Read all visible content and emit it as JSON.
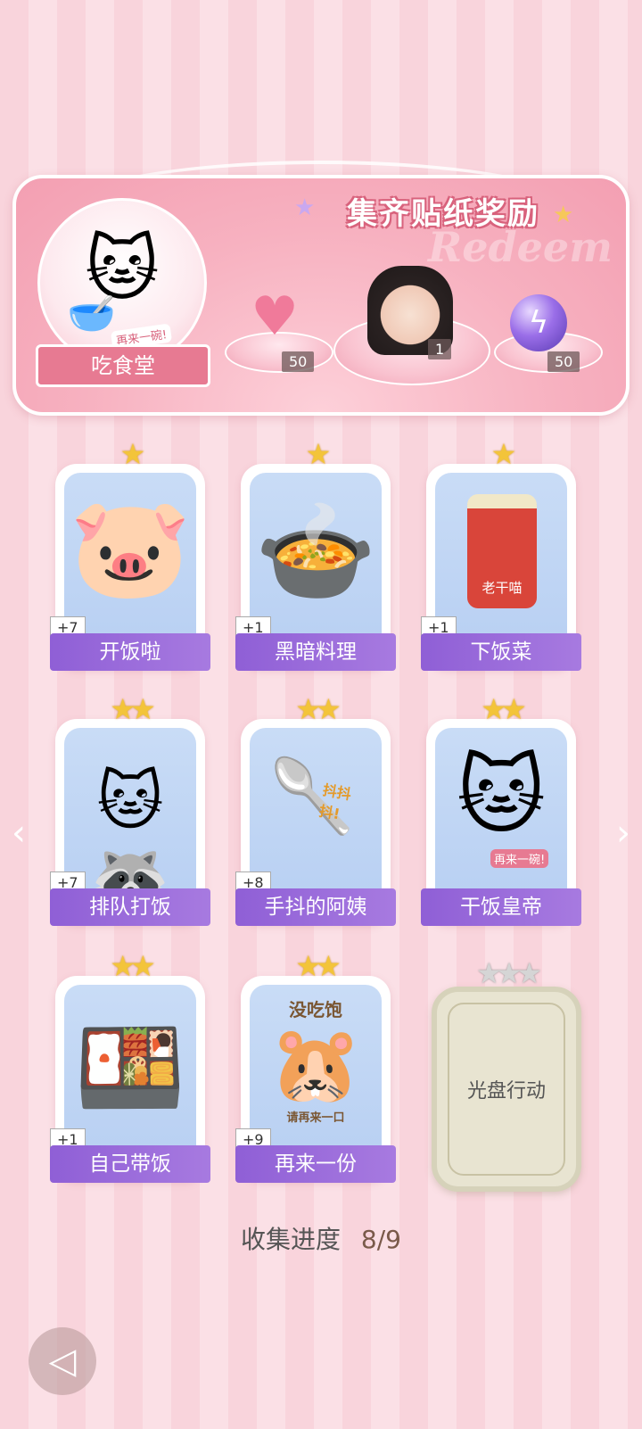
{
  "banner": {
    "title": "集齐贴纸奖励",
    "watermark": "Redeem",
    "badge_label": "吃食堂",
    "badge_sticker_text": "再来一碗!",
    "rewards": [
      {
        "icon": "heart-gem-icon",
        "count": "50"
      },
      {
        "icon": "hairstyle-portrait-icon",
        "count": "1"
      },
      {
        "icon": "purple-energy-orb-icon",
        "count": "50"
      }
    ]
  },
  "cards": [
    {
      "label": "开饭啦",
      "count": "+7",
      "stars": 1,
      "art": "🐷"
    },
    {
      "label": "黑暗料理",
      "count": "+1",
      "stars": 1,
      "art": "🍲"
    },
    {
      "label": "下饭菜",
      "count": "+1",
      "stars": 1,
      "art": "🫙",
      "jar_text": "老干喵"
    },
    {
      "label": "排队打饭",
      "count": "+7",
      "stars": 2,
      "art": "🐱"
    },
    {
      "label": "手抖的阿姨",
      "count": "+8",
      "stars": 2,
      "art": "🥄",
      "art_text": "抖抖抖!"
    },
    {
      "label": "干饭皇帝",
      "count": "",
      "stars": 2,
      "art": "🐱",
      "art_text": "再来一碗!"
    },
    {
      "label": "自己带饭",
      "count": "+1",
      "stars": 2,
      "art": "🍱"
    },
    {
      "label": "再来一份",
      "count": "+9",
      "stars": 2,
      "art": "🐹",
      "art_text_top": "没吃饱",
      "art_text_bottom": "请再来一口"
    },
    {
      "label": "光盘行动",
      "locked": true,
      "stars": 3
    }
  ],
  "progress": {
    "label": "收集进度",
    "value": "8/9"
  },
  "nav": {
    "prev": "‹",
    "next": "›",
    "back_icon": "back-arrow-icon"
  }
}
